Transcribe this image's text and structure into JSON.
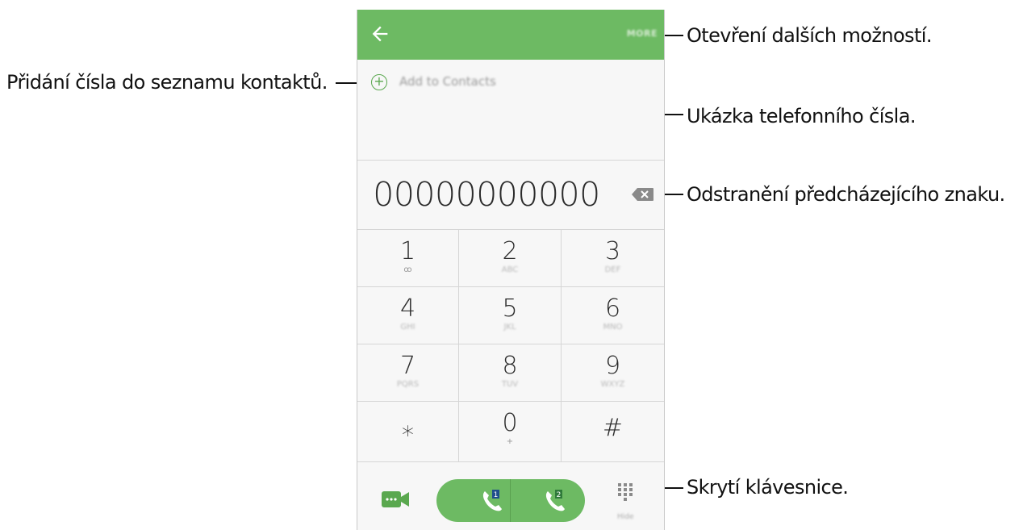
{
  "callouts": {
    "more_options": "Otevření dalších možností.",
    "add_contact": "Přidání čísla do seznamu kontaktů.",
    "number_preview": "Ukázka telefonního čísla.",
    "delete_char": "Odstranění předcházejícího znaku.",
    "hide_keypad": "Skrytí klávesnice."
  },
  "app": {
    "more_label": "MORE",
    "add_to_contacts": "Add to Contacts",
    "phone_number": "00000000000",
    "hide_label": "Hide",
    "accent_color": "#6dba63"
  },
  "keypad": [
    {
      "digit": "1",
      "sub": "ꝏ"
    },
    {
      "digit": "2",
      "sub": "ABC"
    },
    {
      "digit": "3",
      "sub": "DEF"
    },
    {
      "digit": "4",
      "sub": "GHI"
    },
    {
      "digit": "5",
      "sub": "JKL"
    },
    {
      "digit": "6",
      "sub": "MNO"
    },
    {
      "digit": "7",
      "sub": "PQRS"
    },
    {
      "digit": "8",
      "sub": "TUV"
    },
    {
      "digit": "9",
      "sub": "WXYZ"
    },
    {
      "digit": "⁎",
      "sub": ""
    },
    {
      "digit": "0",
      "sub": "+"
    },
    {
      "digit": "#",
      "sub": ""
    }
  ],
  "sim_labels": [
    "1",
    "2"
  ],
  "icons": [
    "back-arrow-icon",
    "add-circle-icon",
    "backspace-icon",
    "video-call-icon",
    "phone-icon",
    "dialpad-icon"
  ]
}
